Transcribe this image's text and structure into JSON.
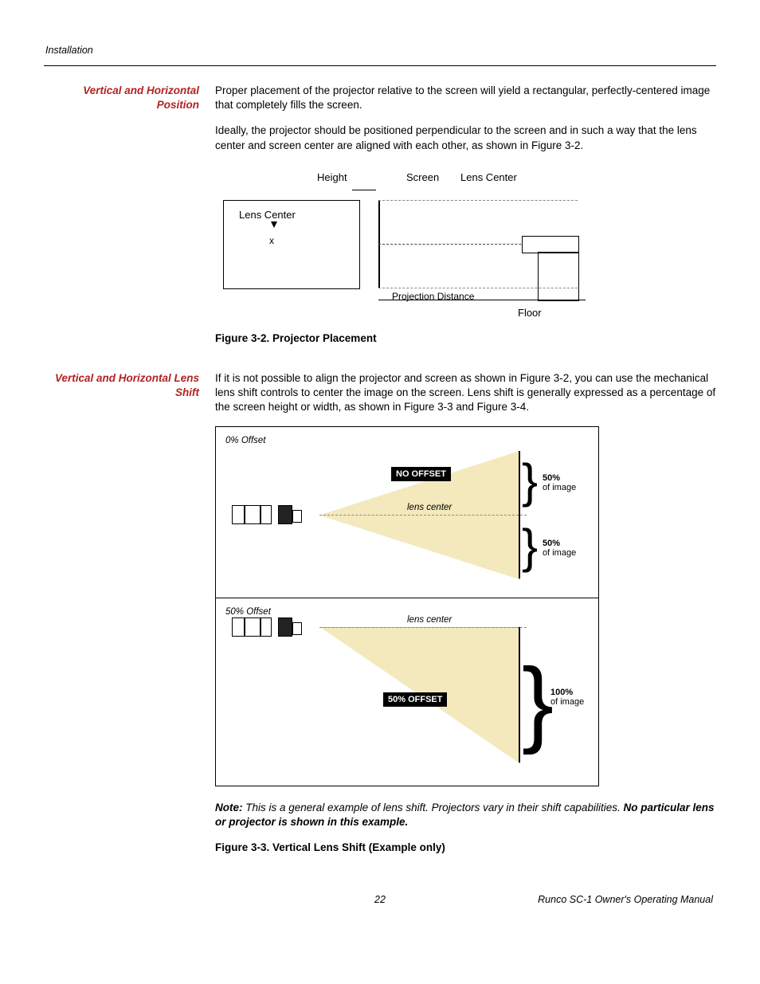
{
  "header": {
    "section": "Installation"
  },
  "s1": {
    "heading": "Vertical and Horizontal Position",
    "p1": "Proper placement of the projector relative to the screen will yield a rectangular, perfectly-centered image that completely fills the screen.",
    "p2": "Ideally, the projector should be positioned perpendicular to the screen and in such a way that the lens center and screen center are aligned with each other, as shown in Figure 3-2."
  },
  "fig32": {
    "lbl_height": "Height",
    "lbl_screen": "Screen",
    "lbl_lenscenter_top": "Lens Center",
    "lbl_lenscenter_left": "Lens Center",
    "lbl_projdist": "Projection Distance",
    "lbl_floor": "Floor",
    "lbl_x": "x",
    "caption": "Figure 3-2. Projector Placement"
  },
  "s2": {
    "heading": "Vertical and Horizontal Lens Shift",
    "p1": "If it is not possible to align the projector and screen as shown in Figure 3-2, you can use the mechanical lens shift controls to center the image on the screen. Lens shift is generally expressed as a percentage of the screen height or width, as shown in Figure 3-3 and Figure 3-4."
  },
  "fig33": {
    "top_offset": "0% Offset",
    "bottom_offset": "50% Offset",
    "pill_no": "NO OFFSET",
    "pill_50": "50% OFFSET",
    "lenscenter": "lens center",
    "pct50": "50%",
    "pct100": "100%",
    "ofimage": "of image",
    "caption": "Figure 3-3. Vertical Lens Shift (Example only)"
  },
  "note": {
    "lead": "Note:",
    "body": " This is a general example of lens shift. Projectors vary in their shift capabilities. ",
    "tail": "No particular lens or projector is shown in this example."
  },
  "footer": {
    "page": "22",
    "title": "Runco SC-1 Owner's Operating Manual"
  }
}
